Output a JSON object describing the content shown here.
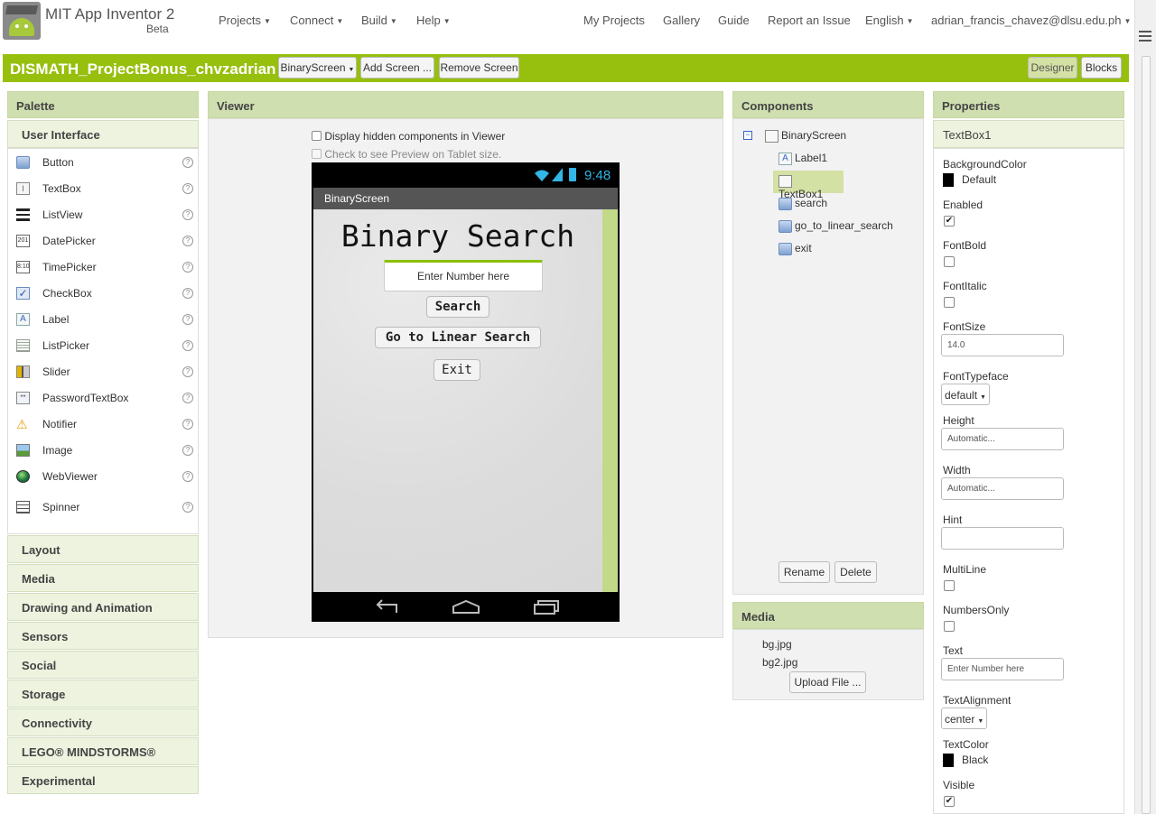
{
  "header": {
    "app_name": "MIT App Inventor 2",
    "beta": "Beta",
    "menus": [
      "Projects",
      "Connect",
      "Build",
      "Help"
    ],
    "links": [
      "My Projects",
      "Gallery",
      "Guide",
      "Report an Issue"
    ],
    "language": "English",
    "user": "adrian_francis_chavez@dlsu.edu.ph"
  },
  "project": {
    "name": "DISMATH_ProjectBonus_chvzadrian",
    "screen_select": "BinaryScreen",
    "add_screen": "Add Screen ...",
    "remove_screen": "Remove Screen",
    "designer": "Designer",
    "blocks": "Blocks"
  },
  "palette": {
    "title": "Palette",
    "section": "User Interface",
    "items": [
      {
        "label": "Button",
        "icon": "button-icon"
      },
      {
        "label": "TextBox",
        "icon": "textbox-icon"
      },
      {
        "label": "ListView",
        "icon": "listview-icon"
      },
      {
        "label": "DatePicker",
        "icon": "datepicker-icon"
      },
      {
        "label": "TimePicker",
        "icon": "timepicker-icon"
      },
      {
        "label": "CheckBox",
        "icon": "checkbox-icon"
      },
      {
        "label": "Label",
        "icon": "label-icon"
      },
      {
        "label": "ListPicker",
        "icon": "listpicker-icon"
      },
      {
        "label": "Slider",
        "icon": "slider-icon"
      },
      {
        "label": "PasswordTextBox",
        "icon": "passwordtextbox-icon"
      },
      {
        "label": "Notifier",
        "icon": "notifier-icon"
      },
      {
        "label": "Image",
        "icon": "image-icon"
      },
      {
        "label": "WebViewer",
        "icon": "webviewer-icon"
      },
      {
        "label": "Spinner",
        "icon": "spinner-icon"
      }
    ],
    "categories": [
      "Layout",
      "Media",
      "Drawing and Animation",
      "Sensors",
      "Social",
      "Storage",
      "Connectivity",
      "LEGO® MINDSTORMS®",
      "Experimental"
    ]
  },
  "viewer": {
    "title": "Viewer",
    "display_hidden": "Display hidden components in Viewer",
    "tablet_preview": "Check to see Preview on Tablet size.",
    "phone": {
      "time": "9:48",
      "screen_title": "BinaryScreen",
      "heading": "Binary Search",
      "textbox_hint": "Enter Number here",
      "search_button": "Search",
      "linear_button": "Go to Linear Search",
      "exit_button": "Exit"
    }
  },
  "components": {
    "title": "Components",
    "root": "BinaryScreen",
    "children": [
      "Label1",
      "TextBox1",
      "search",
      "go_to_linear_search",
      "exit"
    ],
    "selected": "TextBox1",
    "rename": "Rename",
    "delete": "Delete"
  },
  "media": {
    "title": "Media",
    "files": [
      "bg.jpg",
      "bg2.jpg"
    ],
    "upload": "Upload File ..."
  },
  "properties": {
    "title": "Properties",
    "component": "TextBox1",
    "background_color_label": "BackgroundColor",
    "background_color_value": "Default",
    "enabled_label": "Enabled",
    "enabled": true,
    "fontbold_label": "FontBold",
    "fontbold": false,
    "fontitalic_label": "FontItalic",
    "fontitalic": false,
    "fontsize_label": "FontSize",
    "fontsize": "14.0",
    "fonttypeface_label": "FontTypeface",
    "fonttypeface": "default",
    "height_label": "Height",
    "height": "Automatic...",
    "width_label": "Width",
    "width": "Automatic...",
    "hint_label": "Hint",
    "hint": "",
    "multiline_label": "MultiLine",
    "multiline": false,
    "numbersonly_label": "NumbersOnly",
    "numbersonly": false,
    "text_label": "Text",
    "text": "Enter Number here",
    "textalignment_label": "TextAlignment",
    "textalignment": "center",
    "textcolor_label": "TextColor",
    "textcolor": "Black",
    "visible_label": "Visible",
    "visible": true
  },
  "colors": {
    "accent": "#97bf0d",
    "panel_header": "#cfdfb0",
    "selected": "#d3e1a4"
  }
}
